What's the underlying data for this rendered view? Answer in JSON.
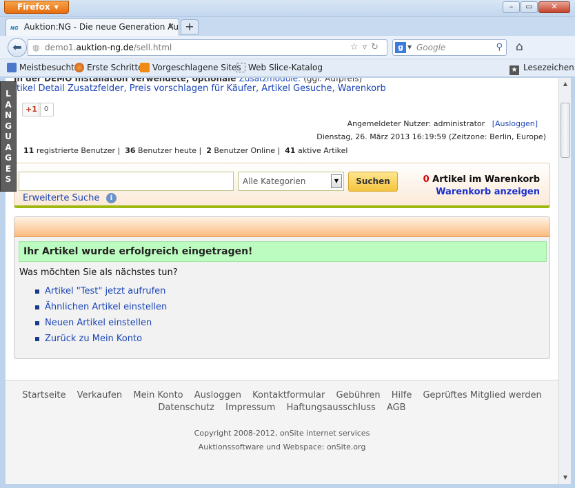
{
  "browser": {
    "menu_button": "Firefox",
    "tab_title": "Auktion:NG - Die neue Generation Aukt...",
    "tab_favicon": "NG",
    "url_prefix": "demo1.",
    "url_domain": "auktion-ng.de",
    "url_path": "/sell.html",
    "search_placeholder": "Google",
    "bookmarks": [
      "Meistbesucht",
      "Erste Schritte",
      "Vorgeschlagene Sites",
      "Web Slice-Katalog"
    ],
    "bookmarks_menu": "Lesezeichen"
  },
  "page": {
    "languages_tab": [
      "L",
      "A",
      "N",
      "G",
      "U",
      "A",
      "G",
      "E",
      "S"
    ],
    "cut_text": "In der DEMO Installation verwendete, optionale",
    "cut_link": "Zusatzmodule:",
    "cut_suffix": "(ggf. Aufpreis)",
    "feature_links": "tikel Detail Zusatzfelder, Preis vorschlagen für Käufer, Artikel Gesuche, Warenkorb",
    "plusone": "+1",
    "plusone_count": "0",
    "user_label": "Angemeldeter Nutzer: administrator",
    "logout": "[Ausloggen]",
    "datetime": "Dienstag, 26. März 2013 16:19:59 (Zeitzone: Berlin, Europe)",
    "stats": {
      "registered_n": "11",
      "registered_l": "registrierte Benutzer",
      "today_n": "36",
      "today_l": "Benutzer heute",
      "online_n": "2",
      "online_l": "Benutzer Online",
      "active_n": "41",
      "active_l": "aktive Artikel"
    },
    "search": {
      "input_value": "",
      "category": "Alle Kategorien",
      "button": "Suchen",
      "advanced": "Erweiterte Suche",
      "cart_count": "0",
      "cart_label": "Artikel im Warenkorb",
      "cart_link": "Warenkorb anzeigen"
    },
    "result": {
      "success": "Ihr Artikel wurde erfolgreich eingetragen!",
      "question": "Was möchten Sie als nächstes tun?",
      "actions": [
        "Artikel \"Test\" jetzt aufrufen",
        "Ähnlichen Artikel einstellen",
        "Neuen Artikel einstellen",
        "Zurück zu Mein Konto"
      ]
    },
    "footer": {
      "row1": [
        "Startseite",
        "Verkaufen",
        "Mein Konto",
        "Ausloggen",
        "Kontaktformular",
        "Gebühren",
        "Hilfe",
        "Geprüftes Mitglied werden"
      ],
      "row2": [
        "Datenschutz",
        "Impressum",
        "Haftungsausschluss",
        "AGB"
      ],
      "copyright": "Copyright 2008-2012, onSite internet services",
      "software": "Auktionssoftware und Webspace: onSite.org"
    }
  },
  "colors": {
    "accent_orange": "#e86d10",
    "link": "#1a45b5",
    "success_bg": "#bdfcc0",
    "cart_red": "#d00000"
  }
}
